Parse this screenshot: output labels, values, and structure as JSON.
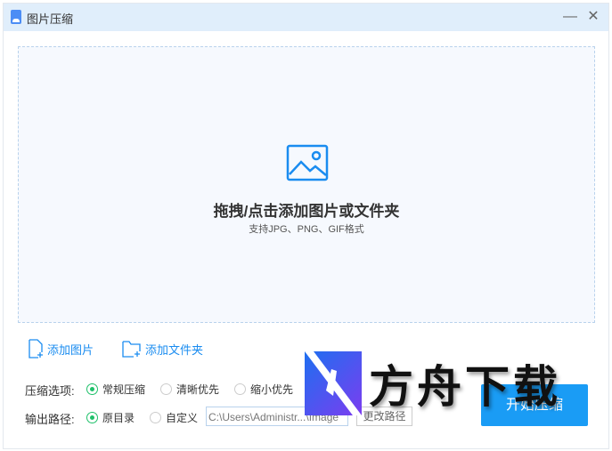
{
  "window": {
    "title": "图片压缩",
    "minimize_icon": "minimize-icon",
    "close_icon": "close-icon"
  },
  "drop": {
    "title": "拖拽/点击添加图片或文件夹",
    "subtitle": "支持JPG、PNG、GIF格式"
  },
  "actions": {
    "add_image": "添加图片",
    "add_folder": "添加文件夹"
  },
  "options": {
    "label": "压缩选项:",
    "items": [
      {
        "label": "常规压缩",
        "selected": true
      },
      {
        "label": "清晰优先",
        "selected": false
      },
      {
        "label": "缩小优先",
        "selected": false
      }
    ]
  },
  "output": {
    "label": "输出路径:",
    "items": [
      {
        "label": "原目录",
        "selected": true
      },
      {
        "label": "自定义",
        "selected": false
      }
    ],
    "path": "C:\\Users\\Administr...\\Image",
    "change_label": "更改路径"
  },
  "start_label": "开始压缩",
  "watermark": "方舟下载"
}
